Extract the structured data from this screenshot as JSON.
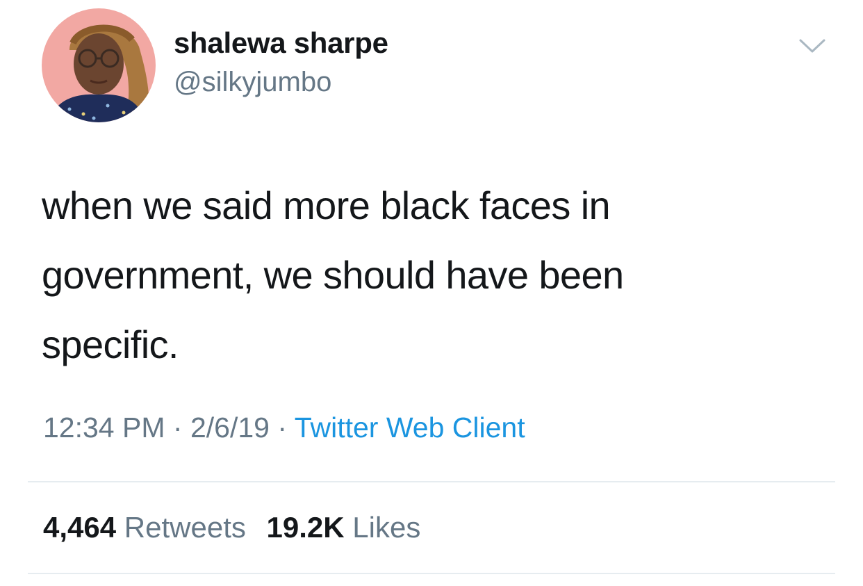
{
  "tweet": {
    "author": {
      "display_name": "shalewa sharpe",
      "handle": "@silkyjumbo"
    },
    "text_lines": [
      "when we said more black faces in",
      "government, we should have been",
      "specific."
    ],
    "time": "12:34 PM",
    "date": "2/6/19",
    "separator": "·",
    "source": "Twitter Web Client",
    "stats": {
      "retweets_count": "4,464",
      "retweets_label": "Retweets",
      "likes_count": "19.2K",
      "likes_label": "Likes"
    }
  },
  "icons": {
    "menu": "chevron-down-icon"
  },
  "colors": {
    "text_primary": "#14171a",
    "text_secondary": "#657786",
    "link": "#1b95e0",
    "divider": "#e6ecf0",
    "avatar_background": "#f2a8a3"
  }
}
